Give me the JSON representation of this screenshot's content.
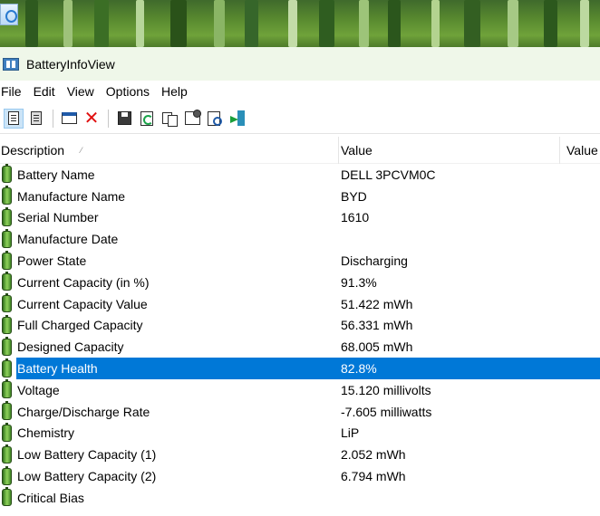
{
  "window": {
    "title": "BatteryInfoView"
  },
  "menu": [
    "File",
    "Edit",
    "View",
    "Options",
    "Help"
  ],
  "toolbar": {
    "buttons": [
      "html-report-all-icon",
      "html-report-selected-icon",
      "window-icon",
      "delete-icon",
      "save-icon",
      "refresh-icon",
      "copy-icon",
      "properties-icon",
      "find-icon",
      "exit-icon"
    ]
  },
  "columns": {
    "description": "Description",
    "value": "Value",
    "value2": "Value"
  },
  "rows": [
    {
      "description": "Battery Name",
      "value": "DELL 3PCVM0C"
    },
    {
      "description": "Manufacture Name",
      "value": "BYD"
    },
    {
      "description": "Serial Number",
      "value": "1610"
    },
    {
      "description": "Manufacture Date",
      "value": ""
    },
    {
      "description": "Power State",
      "value": "Discharging"
    },
    {
      "description": "Current Capacity (in %)",
      "value": "91.3%"
    },
    {
      "description": "Current Capacity Value",
      "value": "51.422 mWh"
    },
    {
      "description": "Full Charged Capacity",
      "value": "56.331 mWh"
    },
    {
      "description": "Designed Capacity",
      "value": "68.005 mWh"
    },
    {
      "description": "Battery Health",
      "value": "82.8%",
      "selected": true
    },
    {
      "description": "Voltage",
      "value": "15.120 millivolts"
    },
    {
      "description": "Charge/Discharge Rate",
      "value": "-7.605 milliwatts"
    },
    {
      "description": "Chemistry",
      "value": "LiP"
    },
    {
      "description": "Low Battery Capacity (1)",
      "value": "2.052 mWh"
    },
    {
      "description": "Low Battery Capacity (2)",
      "value": "6.794 mWh"
    },
    {
      "description": "Critical Bias",
      "value": ""
    }
  ],
  "colors": {
    "selection": "#0078d7",
    "titlebar": "#eff7e9",
    "battery_icon": "#6fb545"
  }
}
